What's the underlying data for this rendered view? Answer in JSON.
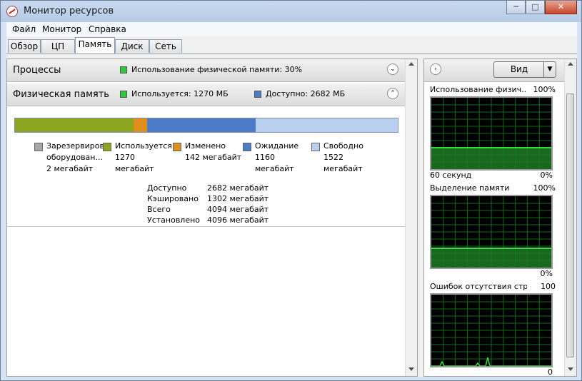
{
  "window": {
    "title": "Монитор ресурсов",
    "minimize": "─",
    "maximize": "□",
    "close": "✕"
  },
  "menu": [
    "Файл",
    "Монитор",
    "Справка"
  ],
  "tabs": [
    {
      "label": "Обзор",
      "active": false
    },
    {
      "label": "ЦП",
      "active": false
    },
    {
      "label": "Память",
      "active": true
    },
    {
      "label": "Диск",
      "active": false
    },
    {
      "label": "Сеть",
      "active": false
    }
  ],
  "processes": {
    "title": "Процессы",
    "info": "Использование физической памяти: 30%"
  },
  "physical_memory": {
    "title": "Физическая память",
    "used_info": "Используется: 1270 МБ",
    "available_info": "Доступно: 2682 МБ",
    "segments": [
      {
        "name": "reserved",
        "mb": 2,
        "color": "#a8a8a8"
      },
      {
        "name": "in-use",
        "mb": 1270,
        "color": "#8ea61f"
      },
      {
        "name": "modified",
        "mb": 142,
        "color": "#e08e1a"
      },
      {
        "name": "standby",
        "mb": 1160,
        "color": "#4a7cc8"
      },
      {
        "name": "free",
        "mb": 1522,
        "color": "#b8d0ee"
      }
    ],
    "legend": [
      {
        "line1": "Зарезервиров",
        "line2": "оборудован...",
        "line3": "2 мегабайт",
        "color": "#a8a8a8"
      },
      {
        "line1": "Используется",
        "line2": "1270",
        "line3": "мегабайт",
        "color": "#8ea61f"
      },
      {
        "line1": "Изменено",
        "line2": "142 мегабайт",
        "line3": "",
        "color": "#e08e1a"
      },
      {
        "line1": "Ожидание",
        "line2": "1160",
        "line3": "мегабайт",
        "color": "#4a7cc8"
      },
      {
        "line1": "Свободно",
        "line2": "1522",
        "line3": "мегабайт",
        "color": "#b8d0ee"
      }
    ],
    "stats": [
      {
        "label": "Доступно",
        "value": "2682 мегабайт"
      },
      {
        "label": "Кэшировано",
        "value": "1302 мегабайт"
      },
      {
        "label": "Всего",
        "value": "4094 мегабайт"
      },
      {
        "label": "Установлено",
        "value": "4096 мегабайт"
      }
    ]
  },
  "right_panel": {
    "view_label": "Вид",
    "graphs": [
      {
        "title": "Использование физич...",
        "max": "100%",
        "foot_left": "60 секунд",
        "foot_right": "0%",
        "level": 0.3
      },
      {
        "title": "Выделение памяти",
        "max": "100%",
        "foot_left": "",
        "foot_right": "0%",
        "level": 0.27
      },
      {
        "title": "Ошибок отсутствия стр...",
        "max": "100",
        "foot_left": "",
        "foot_right": "0",
        "level": 0.0
      }
    ]
  },
  "colors": {
    "graph_grid": "#0a6b1a",
    "graph_line": "#35e03d",
    "graph_fill": "#1d7a25"
  }
}
